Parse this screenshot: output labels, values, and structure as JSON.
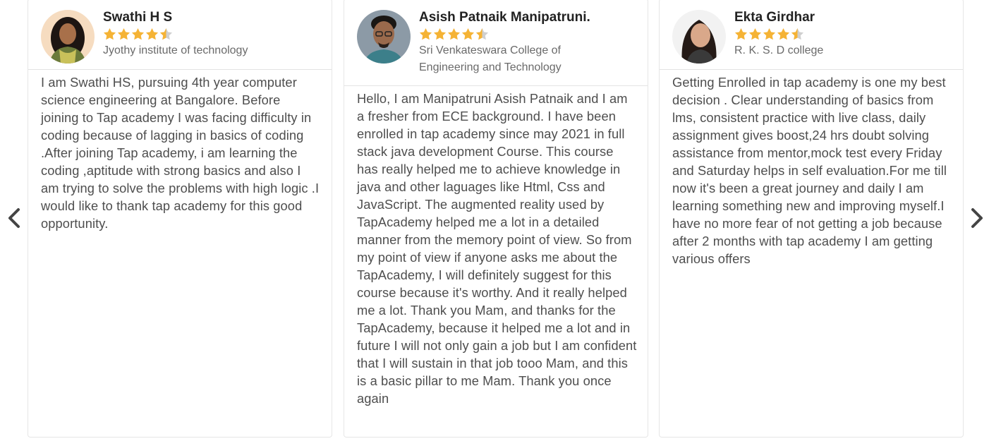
{
  "carousel": {
    "prev_icon": "chevron-left-icon",
    "next_icon": "chevron-right-icon"
  },
  "colors": {
    "star": "#f5b335",
    "star_empty": "#cfcfcf",
    "border": "#e6e6e6"
  },
  "testimonials": [
    {
      "name": "Swathi H S",
      "rating": 4.5,
      "college": "Jyothy institute of technology",
      "review": "I am Swathi HS, pursuing 4th year computer science engineering at Bangalore. Before joining to Tap academy I was facing difficulty in coding because of lagging in basics of coding .After joining Tap academy, i am learning the coding ,aptitude with strong basics and also I am trying to solve the problems with high logic .I would like to thank tap academy for this good opportunity."
    },
    {
      "name": "Asish Patnaik Manipatruni.",
      "rating": 4.5,
      "college": "Sri Venkateswara College of Engineering and Technology",
      "review": "Hello, I am Manipatruni Asish Patnaik and I am a fresher from ECE background. I have been enrolled in tap academy since may 2021 in full stack java development Course. This course has really helped me to achieve knowledge in java and other laguages like Html, Css and JavaScript. The augmented reality used by TapAcademy helped me a lot in a detailed manner from the memory point of view. So from my point of view if anyone asks me about the TapAcademy, I will definitely suggest for this course because it's worthy. And it really helped me a lot. Thank you Mam, and thanks for the TapAcademy, because it helped me a lot and in future I will not only gain a job but I am confident that I will sustain in that job tooo Mam, and this is a basic pillar to me Mam. Thank you once again"
    },
    {
      "name": "Ekta Girdhar",
      "rating": 4.5,
      "college": "R. K. S. D college",
      "review": "Getting Enrolled in tap academy is one my best decision . Clear understanding of basics from lms, consistent practice with live class, daily assignment gives boost,24 hrs doubt solving assistance from mentor,mock test every Friday and Saturday helps in self evaluation.For me till now it's been a great journey and daily I am learning something new and improving myself.I have no more fear of not getting a job because after 2 months with tap academy I am getting various offers"
    }
  ]
}
